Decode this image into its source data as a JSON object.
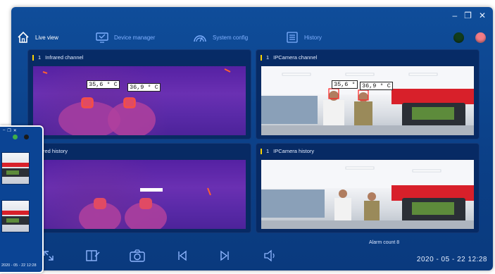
{
  "window_controls": {
    "minimize": "–",
    "restore": "❐",
    "close": "✕"
  },
  "nav": {
    "items": [
      {
        "label": "Live view",
        "icon": "home-icon",
        "active": true
      },
      {
        "label": "Device manager",
        "icon": "monitor-icon",
        "active": false
      },
      {
        "label": "System config",
        "icon": "gauge-icon",
        "active": false
      },
      {
        "label": "History",
        "icon": "list-icon",
        "active": false
      }
    ],
    "status_colors": {
      "green": "#123d1c",
      "red": "#f17c86"
    }
  },
  "panels": {
    "infrared_channel": {
      "index": "1",
      "title": "Infrared channel",
      "temps": [
        "35,6 ° C",
        "36,9 ° C"
      ]
    },
    "ipcamera_channel": {
      "index": "1",
      "title": "IPCamera channel",
      "temps": [
        "35,6 °",
        "36,9 ° C"
      ]
    },
    "infrared_history": {
      "title": "Infrared history"
    },
    "ipcamera_history": {
      "index": "1",
      "title": "IPCamera history"
    }
  },
  "alarm": "Alarm count 8",
  "datetime": "2020 - 05 - 22  12:28",
  "mini_window": {
    "datetime": "2020 - 05 - 22  12:28"
  },
  "toolbar_icons": [
    "fullscreen-icon",
    "edit-layout-icon",
    "camera-icon",
    "previous-icon",
    "next-icon",
    "speaker-icon"
  ],
  "colors": {
    "accent": "#0f4d9a",
    "highlight": "#ffd400",
    "nav_inactive": "#7fb0ff"
  }
}
